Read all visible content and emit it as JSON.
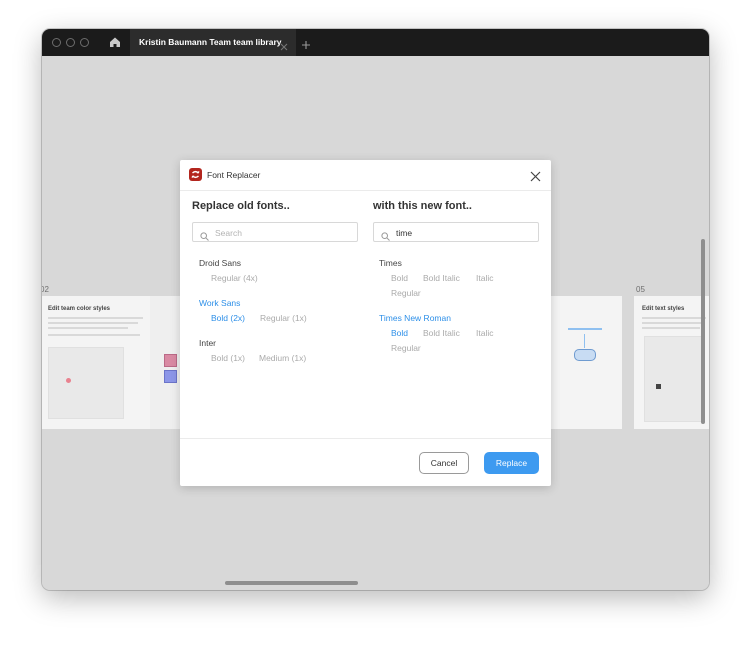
{
  "window": {
    "tab_title": "Kristin Baumann Team team library"
  },
  "canvas": {
    "frames": [
      {
        "label": "02",
        "heading": "Edit team color styles"
      },
      {
        "label": "05",
        "heading": "Edit text styles"
      }
    ]
  },
  "modal": {
    "title": "Font Replacer",
    "left": {
      "heading": "Replace old fonts..",
      "search_placeholder": "Search",
      "search_value": "",
      "fonts": [
        {
          "family": "Droid Sans",
          "styles": [
            "Regular (4x)"
          ]
        },
        {
          "family": "Work Sans",
          "styles": [
            "Bold (2x)",
            "Regular (1x)"
          ]
        },
        {
          "family": "Inter",
          "styles": [
            "Bold (1x)",
            "Medium (1x)"
          ]
        }
      ]
    },
    "right": {
      "heading": "with this new font..",
      "search_placeholder": "Search",
      "search_value": "time",
      "fonts": [
        {
          "family": "Times",
          "styles": [
            "Bold",
            "Bold Italic",
            "Italic",
            "Regular"
          ]
        },
        {
          "family": "Times New Roman",
          "styles": [
            "Bold",
            "Bold Italic",
            "Italic",
            "Regular"
          ]
        }
      ]
    },
    "buttons": {
      "cancel": "Cancel",
      "replace": "Replace"
    }
  },
  "colors": {
    "accent": "#3d9af0",
    "selected_text": "#2d8fe8",
    "plugin_icon": "#b3261e"
  },
  "icons": [
    "home-icon",
    "close-icon",
    "plus-icon",
    "search-icon",
    "font-replacer-logo-icon"
  ]
}
